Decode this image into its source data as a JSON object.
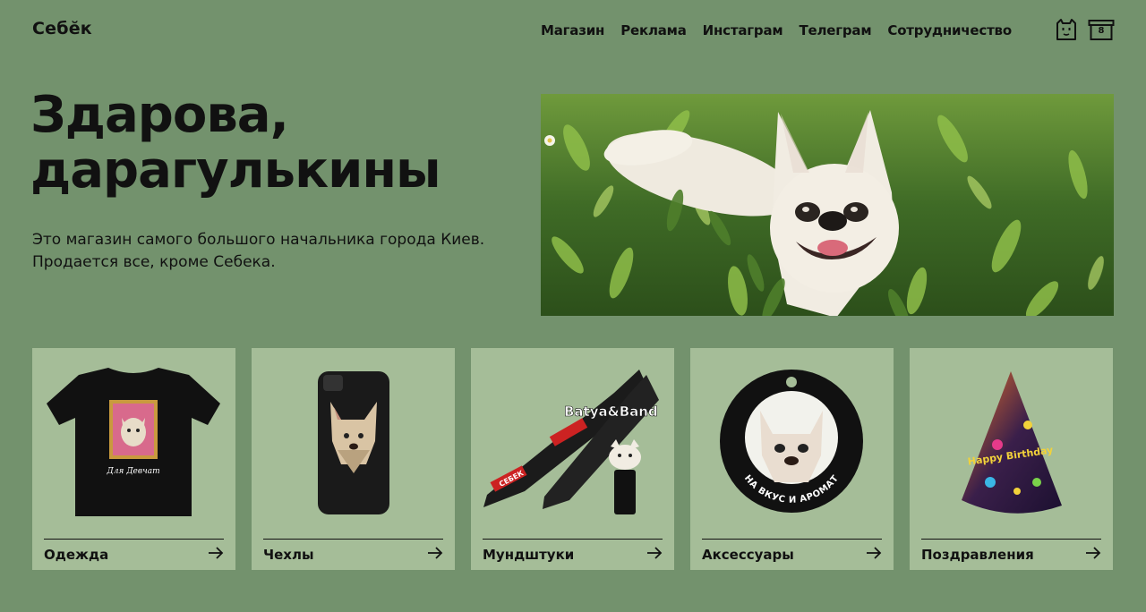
{
  "header": {
    "logo": "Себĕк",
    "nav": [
      "Магазин",
      "Реклама",
      "Инстаграм",
      "Телеграм",
      "Сотрудничество"
    ],
    "cart_count": "8",
    "icons": [
      "cat-face-icon",
      "cart-box-icon"
    ]
  },
  "hero": {
    "title_lines": [
      "Здарова,",
      "дарагулькины"
    ],
    "subtitle_lines": [
      "Это магазин самого большого начальника города Киев.",
      "Продается все, кроме Себека."
    ],
    "image": "chihuahua-in-grass-photo"
  },
  "categories": [
    {
      "label": "Одежда",
      "image": "black-tshirt-photo",
      "print_text": "Для Девчат"
    },
    {
      "label": "Чехлы",
      "image": "phone-case-photo"
    },
    {
      "label": "Мундштуки",
      "image": "lanyard-mouthpiece-photo",
      "print_text": "Batya&Band",
      "strap_text": "СЕБЕК"
    },
    {
      "label": "Аксессуары",
      "image": "round-badge-photo",
      "print_text": "НА ВКУС И АРОМАТ"
    },
    {
      "label": "Поздравления",
      "image": "party-hat-photo",
      "print_text": "Happy Birthday"
    }
  ],
  "colors": {
    "background": "#73926d",
    "card": "#a5bd98",
    "text": "#111111"
  }
}
